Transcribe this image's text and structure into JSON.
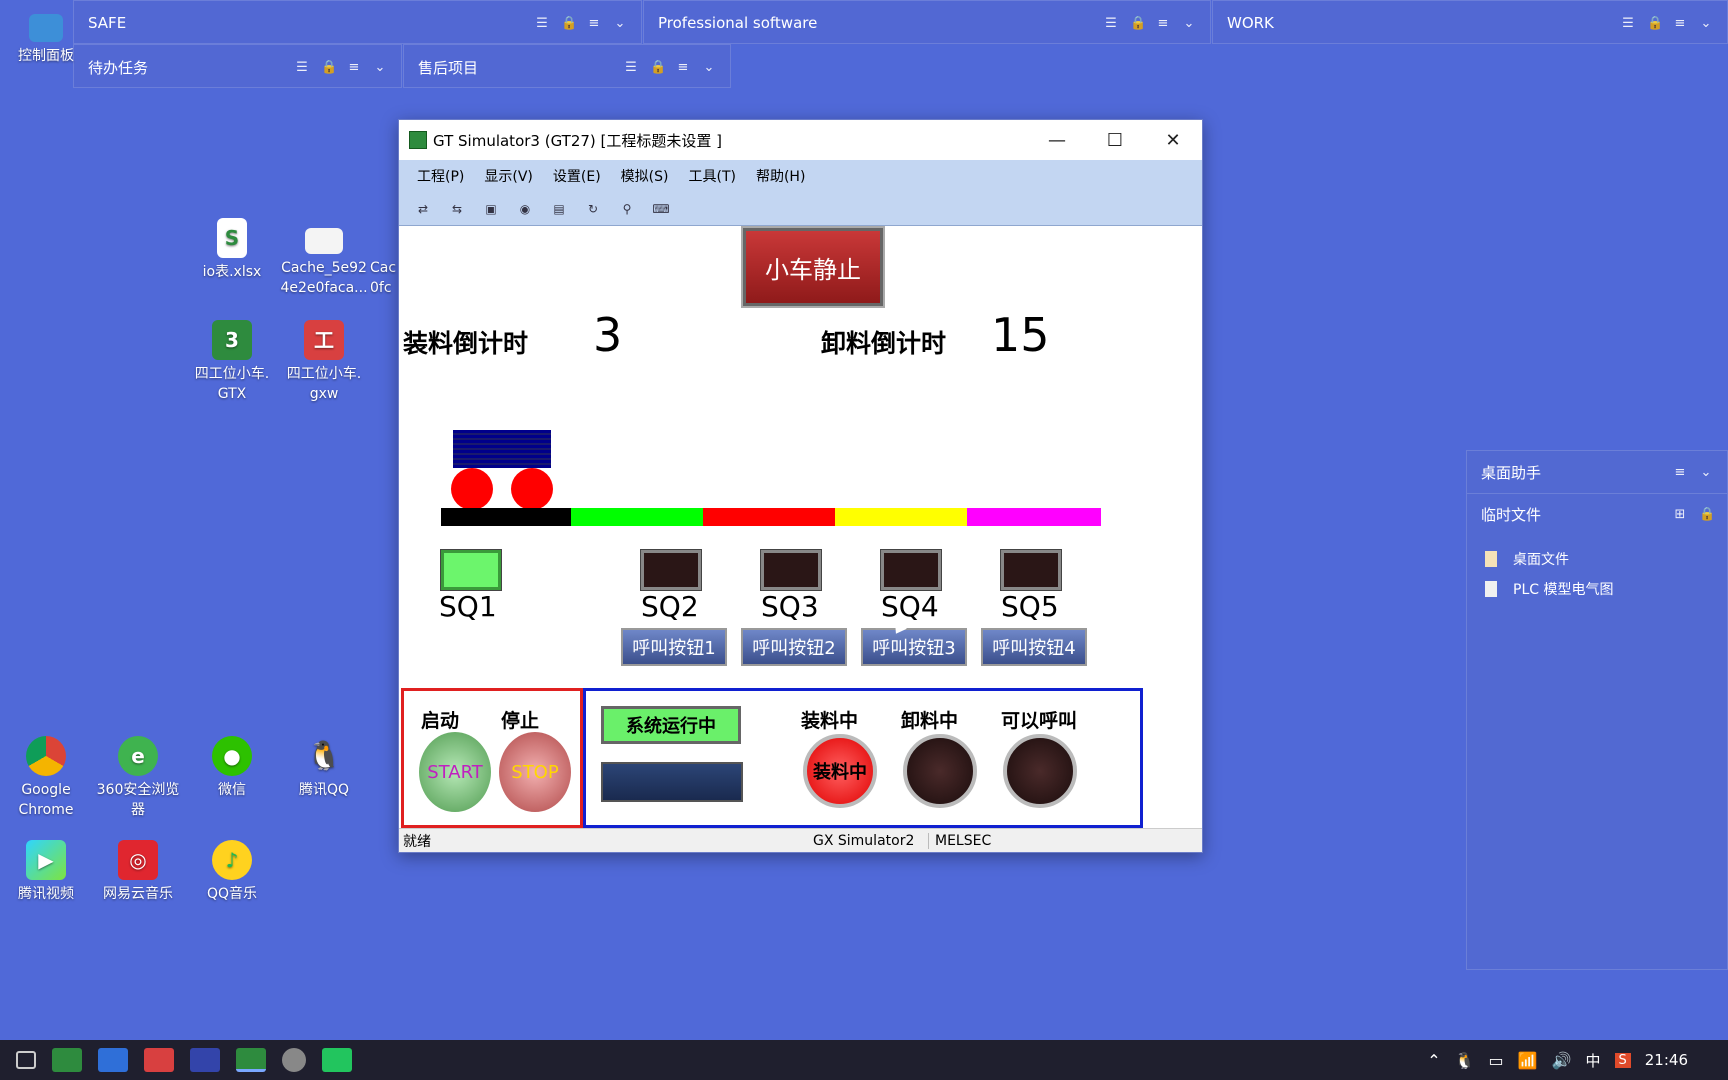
{
  "fences": {
    "safe": {
      "title": "SAFE"
    },
    "professional": {
      "title": "Professional software"
    },
    "work": {
      "title": "WORK"
    },
    "todo": {
      "title": "待办任务"
    },
    "aftersale": {
      "title": "售后项目"
    }
  },
  "desktop_icons": [
    {
      "label": "控制面板"
    },
    {
      "label": "io表.xlsx"
    },
    {
      "label": "Cache_5e92 4e2e0faca..."
    },
    {
      "label": "Cac 0fc"
    },
    {
      "label": "四工位小车. GTX"
    },
    {
      "label": "四工位小车. gxw"
    },
    {
      "label": "Google Chrome"
    },
    {
      "label": "360安全浏览器"
    },
    {
      "label": "微信"
    },
    {
      "label": "腾讯QQ"
    },
    {
      "label": "腾讯视频"
    },
    {
      "label": "网易云音乐"
    },
    {
      "label": "QQ音乐"
    }
  ],
  "window": {
    "title": "GT Simulator3 (GT27)  [工程标题未设置 ]",
    "menu": [
      "工程(P)",
      "显示(V)",
      "设置(E)",
      "模拟(S)",
      "工具(T)",
      "帮助(H)"
    ],
    "status_left": "就绪",
    "status_mid": "GX Simulator2",
    "status_right": "MELSEC"
  },
  "hmi": {
    "car_status": "小车静止",
    "load_countdown_label": "装料倒计时",
    "load_countdown_value": "3",
    "unload_countdown_label": "卸料倒计时",
    "unload_countdown_value": "15",
    "sensors": [
      {
        "label": "SQ1",
        "on": true
      },
      {
        "label": "SQ2",
        "on": false
      },
      {
        "label": "SQ3",
        "on": false
      },
      {
        "label": "SQ4",
        "on": false
      },
      {
        "label": "SQ5",
        "on": false
      }
    ],
    "call_buttons": [
      "呼叫按钮1",
      "呼叫按钮2",
      "呼叫按钮3",
      "呼叫按钮4"
    ],
    "start_label": "启动",
    "stop_label": "停止",
    "start_button": "START",
    "stop_button": "STOP",
    "system_running": "系统运行中",
    "loading_label": "装料中",
    "loading_lamp_text": "装料中",
    "unloading_label": "卸料中",
    "callable_label": "可以呼叫",
    "track_colors": [
      "#000000",
      "#00ff00",
      "#ff0000",
      "#ffff00",
      "#ff00ff"
    ]
  },
  "side_panel": {
    "title": "桌面助手",
    "section": "临时文件",
    "items": [
      "桌面文件",
      "PLC 模型电气图"
    ]
  },
  "taskbar": {
    "ime": "中",
    "time": "21:46"
  }
}
